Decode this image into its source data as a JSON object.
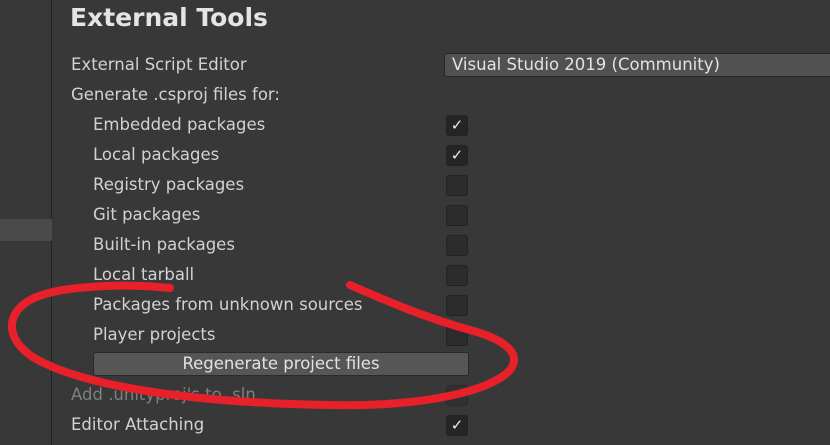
{
  "section": {
    "title": "External Tools"
  },
  "script_editor": {
    "label": "External Script Editor",
    "value": "Visual Studio 2019 (Community)"
  },
  "generate": {
    "label": "Generate .csproj files for:",
    "options": [
      {
        "label": "Embedded packages",
        "checked": true
      },
      {
        "label": "Local packages",
        "checked": true
      },
      {
        "label": "Registry packages",
        "checked": false
      },
      {
        "label": "Git packages",
        "checked": false
      },
      {
        "label": "Built-in packages",
        "checked": false
      },
      {
        "label": "Local tarball",
        "checked": false
      },
      {
        "label": "Packages from unknown sources",
        "checked": false
      },
      {
        "label": "Player projects",
        "checked": false
      }
    ],
    "regenerate_label": "Regenerate project files"
  },
  "add_unityproj": {
    "label": "Add .unityproj's to .sln",
    "checked": false
  },
  "editor_attaching": {
    "label": "Editor Attaching",
    "checked": true
  },
  "icons": {
    "checkmark": "✓"
  },
  "colors": {
    "annotation": "#e8202a",
    "background": "#383838"
  }
}
